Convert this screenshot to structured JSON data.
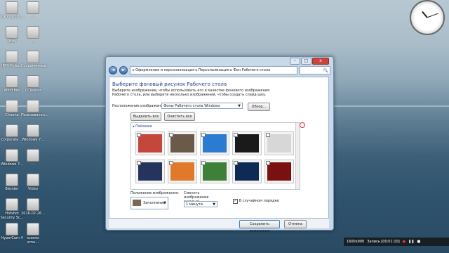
{
  "desktop": {
    "icons": [
      {
        "label": "Inkomstoro...",
        "col": 0,
        "row": 0
      },
      {
        "label": "(Bin)",
        "col": 0,
        "row": 1
      },
      {
        "label": "[RTV-Pulse...",
        "col": 0,
        "row": 2
      },
      {
        "label": "Wind Mel",
        "col": 0,
        "row": 3
      },
      {
        "label": "Chrome",
        "col": 0,
        "row": 4
      },
      {
        "label": "Corporate ...",
        "col": 0,
        "row": 5
      },
      {
        "label": "Windows 7...",
        "col": 0,
        "row": 6
      },
      {
        "label": "Blender",
        "col": 0,
        "row": 7
      },
      {
        "label": "Hotshot Security Sc...",
        "col": 0,
        "row": 8
      },
      {
        "label": "HyperCam 4",
        "col": 0,
        "row": 9
      }
    ],
    "icons_col2": [
      {
        "label": "...",
        "row": 0
      },
      {
        "label": "...",
        "row": 1
      },
      {
        "label": "Сохраненные...",
        "row": 2
      },
      {
        "label": "CCleaner",
        "row": 3
      },
      {
        "label": "Пользовател...",
        "row": 4
      },
      {
        "label": "Windows 7...",
        "row": 5
      },
      {
        "label": "...",
        "row": 6
      },
      {
        "label": "Video",
        "row": 7
      },
      {
        "label": "2016-02-26...",
        "row": 8
      },
      {
        "label": "xcenes emu...",
        "row": 9
      }
    ]
  },
  "window": {
    "nav_back": "◄",
    "nav_fwd": "►",
    "breadcrumb": "▸ Оформление и персонализация ▸ Персонализация ▸ Фон Рабочего стола",
    "search_icon": "🔍",
    "heading": "Выберите фоновый рисунок Рабочего стола",
    "description": "Выберите изображение, чтобы использовать его в качестве фонового изображения Рабочего стола, или выберите несколько изображений, чтобы создать слайд-шоу.",
    "location_label": "Расположение изображения:",
    "location_value": "Фоны Рабочего стола Windows",
    "browse_button": "Обзор...",
    "select_all_button": "Выделить все",
    "clear_all_button": "Очистить все",
    "group_label": "Пейзажи",
    "position_label": "Положение изображения:",
    "position_value": "Заполнение",
    "change_label": "Сменять изображение каждые:",
    "change_value": "1 минута",
    "shuffle_label": "В случайном порядке",
    "save_button": "Сохранить изменения",
    "cancel_button": "Отмена",
    "thumbs": [
      {
        "color": "#c4473b"
      },
      {
        "color": "#6b5a4a"
      },
      {
        "color": "#2b7bd1"
      },
      {
        "color": "#1a1a1a"
      },
      {
        "color": "#d7d7d7"
      },
      {
        "color": "#24345c"
      },
      {
        "color": "#e07a2a"
      },
      {
        "color": "#3e7f3a"
      },
      {
        "color": "#0f2a55"
      },
      {
        "color": "#7a1010"
      }
    ]
  },
  "taskbar": {
    "resolution": "1600x900",
    "record": "Запись [00:01:10]"
  }
}
